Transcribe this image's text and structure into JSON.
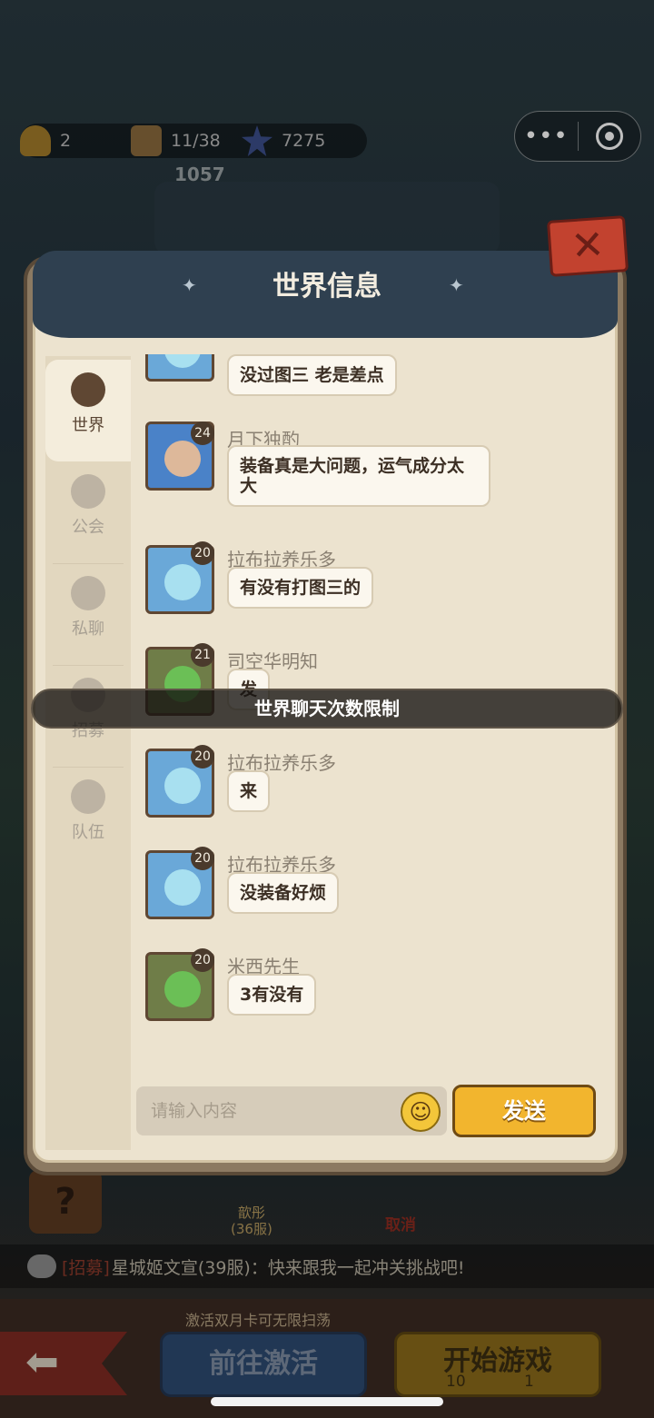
{
  "resources": {
    "bell": "2",
    "cookie": "11/38",
    "star": "7275"
  },
  "score": "1057",
  "capsule": {
    "more": "•••"
  },
  "modal": {
    "title": "世界信息",
    "tabs": [
      {
        "label": "世界",
        "icon": "planet-icon",
        "active": true
      },
      {
        "label": "公会",
        "icon": "guild-badge-icon",
        "active": false
      },
      {
        "label": "私聊",
        "icon": "chat-bubble-icon",
        "active": false
      },
      {
        "label": "招募",
        "icon": "flag-icon",
        "active": false
      },
      {
        "label": "队伍",
        "icon": "team-icon",
        "active": false
      }
    ],
    "messages": [
      {
        "name": "",
        "level": "",
        "text": "没过图三  老是差点"
      },
      {
        "name": "月下独酌",
        "level": "24",
        "text": "装备真是大问题，运气成分太大"
      },
      {
        "name": "拉布拉养乐多",
        "level": "20",
        "text": "有没有打图三的"
      },
      {
        "name": "司空华明知",
        "level": "21",
        "text": "发"
      },
      {
        "name": "拉布拉养乐多",
        "level": "20",
        "text": "来"
      },
      {
        "name": "拉布拉养乐多",
        "level": "20",
        "text": "没装备好烦"
      },
      {
        "name": "米西先生",
        "level": "20",
        "text": "3有没有"
      }
    ],
    "input_placeholder": "请输入内容",
    "send_label": "发送"
  },
  "toast": "世界聊天次数限制",
  "background": {
    "character_name": "歆彤",
    "character_server": "(36服)",
    "exit_label": "取消",
    "ticker_tag": "[招募]",
    "ticker_text": "星城姬文宣(39服)：快来跟我一起冲关挑战吧!",
    "activate_hint": "激活双月卡可无限扫荡",
    "activate_label": "前往激活",
    "start_label": "开始游戏",
    "start_cost_1": "10",
    "start_cost_2": "1"
  },
  "colors": {
    "send_button": "#f2b52e",
    "header": "#2f4050",
    "close": "#c2422f"
  }
}
